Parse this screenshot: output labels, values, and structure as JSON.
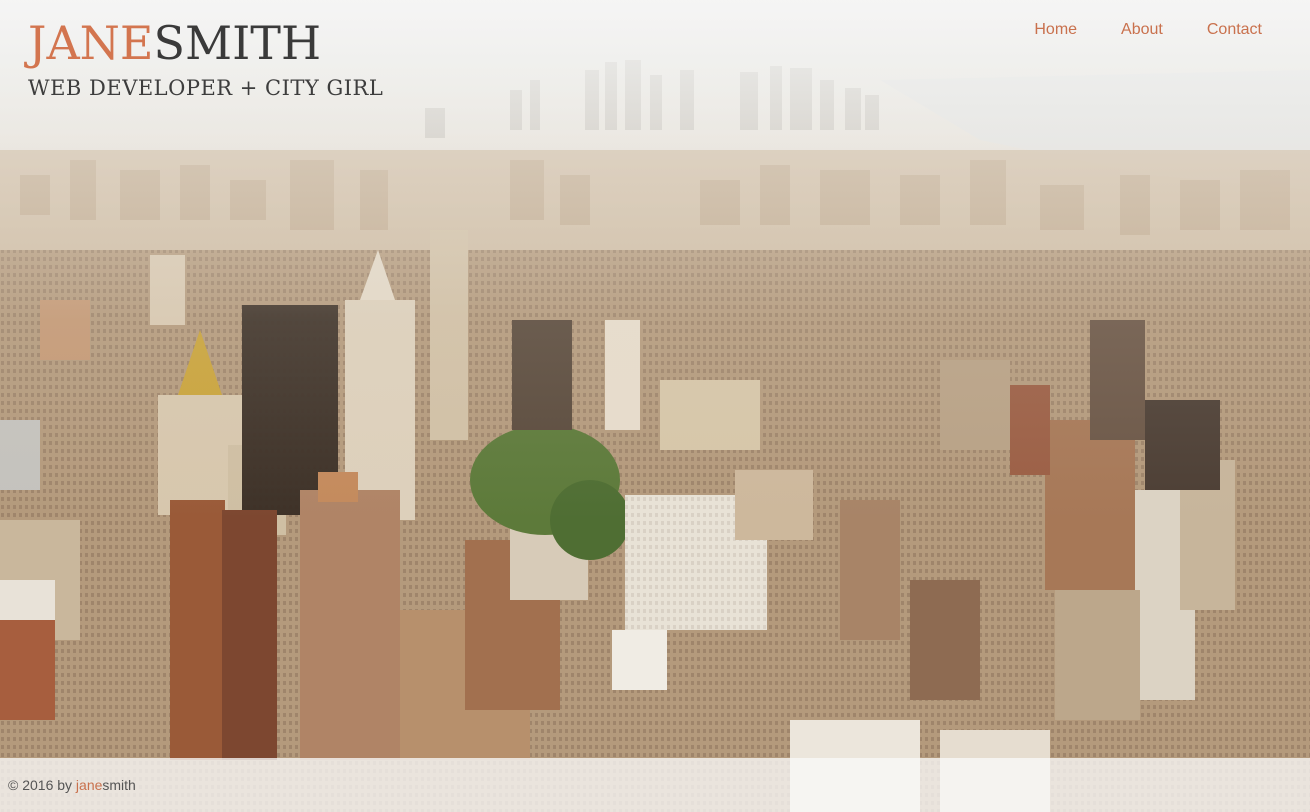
{
  "site": {
    "brand_first": "JANE",
    "brand_last": "SMITH",
    "tagline": "WEB DEVELOPER + CITY GIRL"
  },
  "nav": {
    "items": [
      {
        "label": "Home"
      },
      {
        "label": "About"
      },
      {
        "label": "Contact"
      }
    ]
  },
  "footer": {
    "copyright": "© 2016 by",
    "brand_first": "jane",
    "brand_last": "smith"
  },
  "colors": {
    "accent": "#d3754f",
    "text_dark": "#3a3a3a",
    "footer_bg": "#f8f8f8"
  },
  "background": {
    "subject": "aerial-city-skyline-photo"
  }
}
